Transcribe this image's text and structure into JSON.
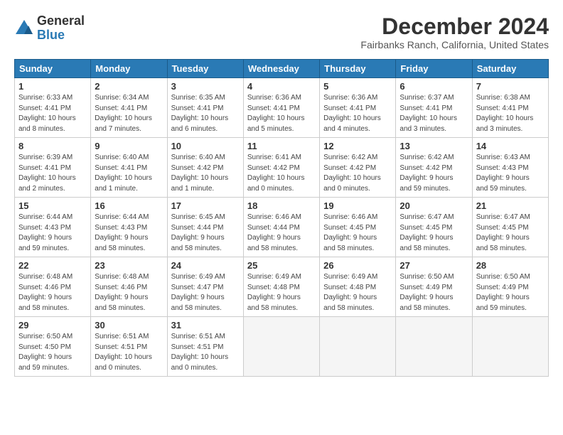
{
  "logo": {
    "general": "General",
    "blue": "Blue"
  },
  "header": {
    "month": "December 2024",
    "location": "Fairbanks Ranch, California, United States"
  },
  "days_of_week": [
    "Sunday",
    "Monday",
    "Tuesday",
    "Wednesday",
    "Thursday",
    "Friday",
    "Saturday"
  ],
  "weeks": [
    [
      {
        "day": "1",
        "info": "Sunrise: 6:33 AM\nSunset: 4:41 PM\nDaylight: 10 hours\nand 8 minutes."
      },
      {
        "day": "2",
        "info": "Sunrise: 6:34 AM\nSunset: 4:41 PM\nDaylight: 10 hours\nand 7 minutes."
      },
      {
        "day": "3",
        "info": "Sunrise: 6:35 AM\nSunset: 4:41 PM\nDaylight: 10 hours\nand 6 minutes."
      },
      {
        "day": "4",
        "info": "Sunrise: 6:36 AM\nSunset: 4:41 PM\nDaylight: 10 hours\nand 5 minutes."
      },
      {
        "day": "5",
        "info": "Sunrise: 6:36 AM\nSunset: 4:41 PM\nDaylight: 10 hours\nand 4 minutes."
      },
      {
        "day": "6",
        "info": "Sunrise: 6:37 AM\nSunset: 4:41 PM\nDaylight: 10 hours\nand 3 minutes."
      },
      {
        "day": "7",
        "info": "Sunrise: 6:38 AM\nSunset: 4:41 PM\nDaylight: 10 hours\nand 3 minutes."
      }
    ],
    [
      {
        "day": "8",
        "info": "Sunrise: 6:39 AM\nSunset: 4:41 PM\nDaylight: 10 hours\nand 2 minutes."
      },
      {
        "day": "9",
        "info": "Sunrise: 6:40 AM\nSunset: 4:41 PM\nDaylight: 10 hours\nand 1 minute."
      },
      {
        "day": "10",
        "info": "Sunrise: 6:40 AM\nSunset: 4:42 PM\nDaylight: 10 hours\nand 1 minute."
      },
      {
        "day": "11",
        "info": "Sunrise: 6:41 AM\nSunset: 4:42 PM\nDaylight: 10 hours\nand 0 minutes."
      },
      {
        "day": "12",
        "info": "Sunrise: 6:42 AM\nSunset: 4:42 PM\nDaylight: 10 hours\nand 0 minutes."
      },
      {
        "day": "13",
        "info": "Sunrise: 6:42 AM\nSunset: 4:42 PM\nDaylight: 9 hours\nand 59 minutes."
      },
      {
        "day": "14",
        "info": "Sunrise: 6:43 AM\nSunset: 4:43 PM\nDaylight: 9 hours\nand 59 minutes."
      }
    ],
    [
      {
        "day": "15",
        "info": "Sunrise: 6:44 AM\nSunset: 4:43 PM\nDaylight: 9 hours\nand 59 minutes."
      },
      {
        "day": "16",
        "info": "Sunrise: 6:44 AM\nSunset: 4:43 PM\nDaylight: 9 hours\nand 58 minutes."
      },
      {
        "day": "17",
        "info": "Sunrise: 6:45 AM\nSunset: 4:44 PM\nDaylight: 9 hours\nand 58 minutes."
      },
      {
        "day": "18",
        "info": "Sunrise: 6:46 AM\nSunset: 4:44 PM\nDaylight: 9 hours\nand 58 minutes."
      },
      {
        "day": "19",
        "info": "Sunrise: 6:46 AM\nSunset: 4:45 PM\nDaylight: 9 hours\nand 58 minutes."
      },
      {
        "day": "20",
        "info": "Sunrise: 6:47 AM\nSunset: 4:45 PM\nDaylight: 9 hours\nand 58 minutes."
      },
      {
        "day": "21",
        "info": "Sunrise: 6:47 AM\nSunset: 4:45 PM\nDaylight: 9 hours\nand 58 minutes."
      }
    ],
    [
      {
        "day": "22",
        "info": "Sunrise: 6:48 AM\nSunset: 4:46 PM\nDaylight: 9 hours\nand 58 minutes."
      },
      {
        "day": "23",
        "info": "Sunrise: 6:48 AM\nSunset: 4:46 PM\nDaylight: 9 hours\nand 58 minutes."
      },
      {
        "day": "24",
        "info": "Sunrise: 6:49 AM\nSunset: 4:47 PM\nDaylight: 9 hours\nand 58 minutes."
      },
      {
        "day": "25",
        "info": "Sunrise: 6:49 AM\nSunset: 4:48 PM\nDaylight: 9 hours\nand 58 minutes."
      },
      {
        "day": "26",
        "info": "Sunrise: 6:49 AM\nSunset: 4:48 PM\nDaylight: 9 hours\nand 58 minutes."
      },
      {
        "day": "27",
        "info": "Sunrise: 6:50 AM\nSunset: 4:49 PM\nDaylight: 9 hours\nand 58 minutes."
      },
      {
        "day": "28",
        "info": "Sunrise: 6:50 AM\nSunset: 4:49 PM\nDaylight: 9 hours\nand 59 minutes."
      }
    ],
    [
      {
        "day": "29",
        "info": "Sunrise: 6:50 AM\nSunset: 4:50 PM\nDaylight: 9 hours\nand 59 minutes."
      },
      {
        "day": "30",
        "info": "Sunrise: 6:51 AM\nSunset: 4:51 PM\nDaylight: 10 hours\nand 0 minutes."
      },
      {
        "day": "31",
        "info": "Sunrise: 6:51 AM\nSunset: 4:51 PM\nDaylight: 10 hours\nand 0 minutes."
      },
      {
        "day": "",
        "info": ""
      },
      {
        "day": "",
        "info": ""
      },
      {
        "day": "",
        "info": ""
      },
      {
        "day": "",
        "info": ""
      }
    ]
  ]
}
